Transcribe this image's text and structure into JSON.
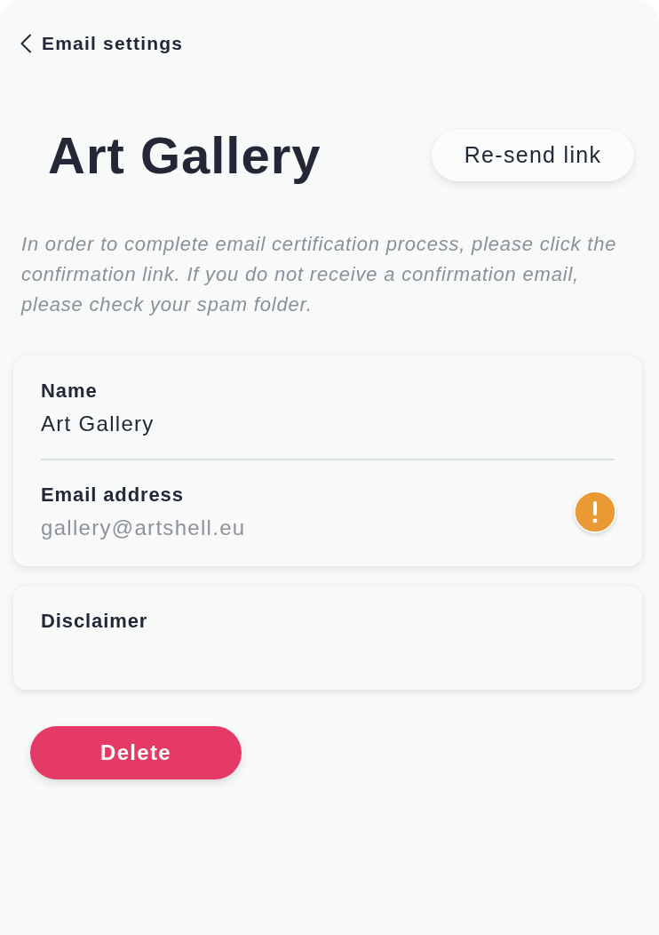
{
  "header": {
    "back_label": "Email settings"
  },
  "title": "Art Gallery",
  "resend_button": "Re-send link",
  "notice": "In order to complete email certification process, please click the confirmation link. If you do not receive a confirmation email, please check your spam folder.",
  "details_card": {
    "fields": [
      {
        "label": "Name",
        "value": "Art Gallery",
        "pending": false
      },
      {
        "label": "Email address",
        "value": "gallery@artshell.eu",
        "pending": true
      }
    ]
  },
  "disclaimer_card": {
    "label": "Disclaimer"
  },
  "delete_button": "Delete"
}
